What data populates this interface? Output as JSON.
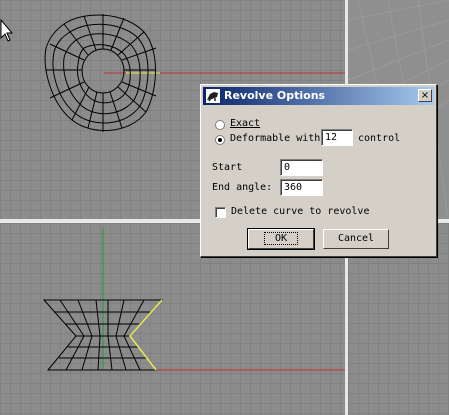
{
  "dialog": {
    "title": "Revolve Options",
    "close_label": "×",
    "exact_label": "Exact",
    "deformable_label": "Deformable with",
    "deformable_value": "12",
    "control_label": "control",
    "start_label": "Start",
    "start_value": "0",
    "end_angle_label": "End angle:",
    "end_angle_value": "360",
    "delete_curve_label": "Delete curve to revolve",
    "ok_label": "OK",
    "cancel_label": "Cancel",
    "selected_option": "deformable",
    "delete_curve_checked": false
  },
  "colors": {
    "title_gradient_start": "#0a246a",
    "title_gradient_end": "#a6caf0",
    "x_axis": "#c03030",
    "y_axis": "#20a020",
    "selected_curve": "#e8e850",
    "wireframe": "#000000"
  },
  "icons": {
    "dialog": "rhino-icon",
    "cursor": "arrow-cursor-icon"
  }
}
